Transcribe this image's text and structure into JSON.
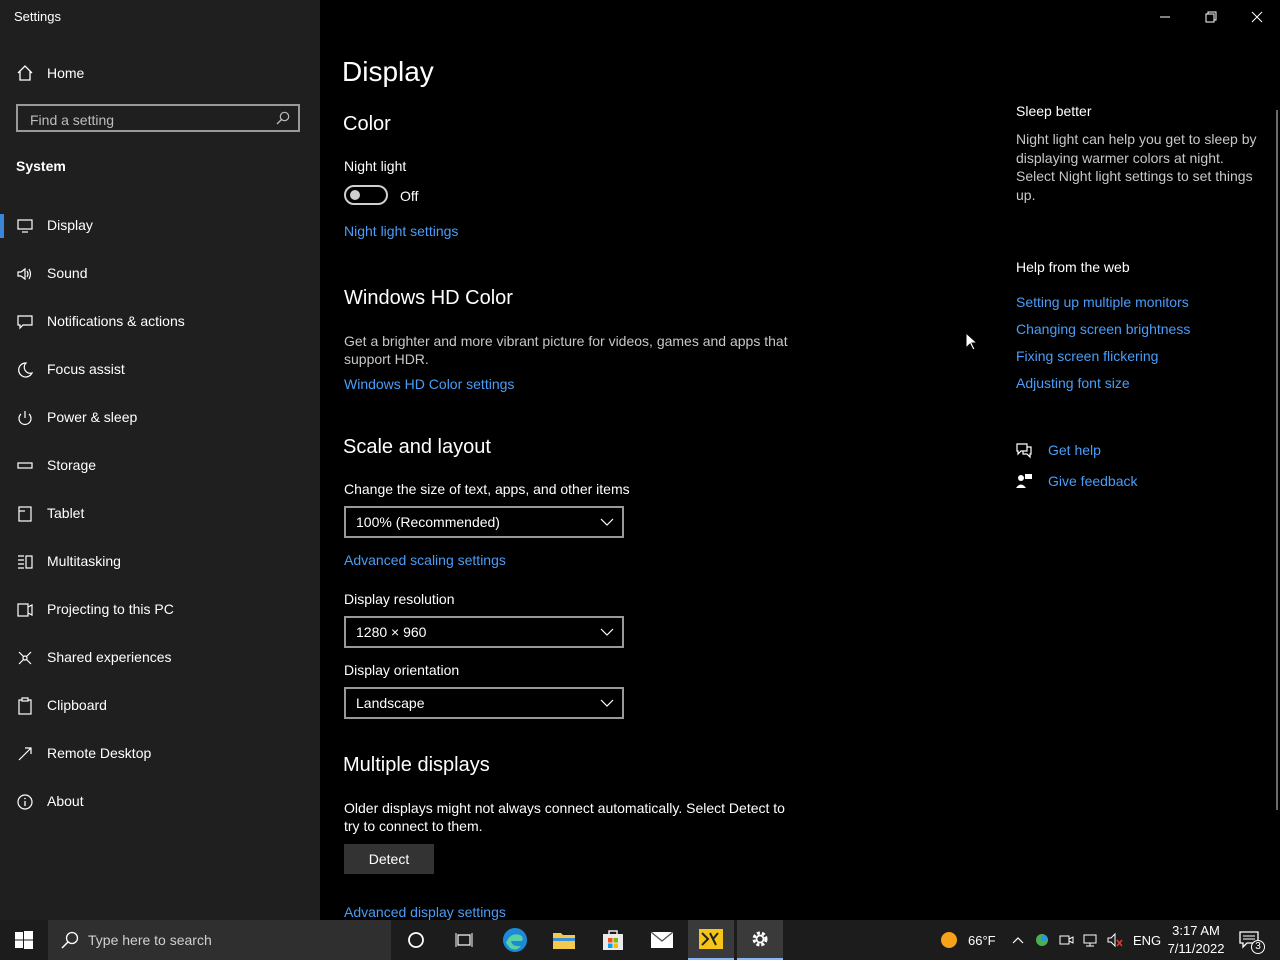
{
  "window": {
    "title": "Settings"
  },
  "sidebar": {
    "home_label": "Home",
    "search_placeholder": "Find a setting",
    "section_label": "System",
    "items": [
      {
        "label": "Display",
        "icon": "monitor-icon",
        "active": true
      },
      {
        "label": "Sound",
        "icon": "speaker-icon"
      },
      {
        "label": "Notifications & actions",
        "icon": "notification-icon"
      },
      {
        "label": "Focus assist",
        "icon": "moon-icon"
      },
      {
        "label": "Power & sleep",
        "icon": "power-icon"
      },
      {
        "label": "Storage",
        "icon": "storage-icon"
      },
      {
        "label": "Tablet",
        "icon": "tablet-icon"
      },
      {
        "label": "Multitasking",
        "icon": "multitasking-icon"
      },
      {
        "label": "Projecting to this PC",
        "icon": "projector-icon"
      },
      {
        "label": "Shared experiences",
        "icon": "shared-icon"
      },
      {
        "label": "Clipboard",
        "icon": "clipboard-icon"
      },
      {
        "label": "Remote Desktop",
        "icon": "remote-icon"
      },
      {
        "label": "About",
        "icon": "info-icon"
      }
    ]
  },
  "main": {
    "title": "Display",
    "color": {
      "heading": "Color",
      "night_light_label": "Night light",
      "toggle_state": "Off",
      "night_light_settings_link": "Night light settings"
    },
    "hd_color": {
      "heading": "Windows HD Color",
      "description": "Get a brighter and more vibrant picture for videos, games and apps that support HDR.",
      "settings_link": "Windows HD Color settings"
    },
    "scale": {
      "heading": "Scale and layout",
      "size_label": "Change the size of text, apps, and other items",
      "size_value": "100% (Recommended)",
      "advanced_scaling_link": "Advanced scaling settings",
      "resolution_label": "Display resolution",
      "resolution_value": "1280 × 960",
      "orientation_label": "Display orientation",
      "orientation_value": "Landscape"
    },
    "multiple": {
      "heading": "Multiple displays",
      "description": "Older displays might not always connect automatically. Select Detect to try to connect to them.",
      "detect_button": "Detect",
      "advanced_display_link": "Advanced display settings"
    }
  },
  "right": {
    "sleep_heading": "Sleep better",
    "sleep_text": "Night light can help you get to sleep by displaying warmer colors at night. Select Night light settings to set things up.",
    "help_heading": "Help from the web",
    "help_links": [
      "Setting up multiple monitors",
      "Changing screen brightness",
      "Fixing screen flickering",
      "Adjusting font size"
    ],
    "get_help": "Get help",
    "give_feedback": "Give feedback"
  },
  "taskbar": {
    "search_placeholder": "Type here to search",
    "weather_temp": "66°F",
    "language": "ENG",
    "time": "3:17 AM",
    "date": "7/11/2022",
    "notification_count": "3"
  },
  "colors": {
    "accent": "#4a9df8",
    "sidebar_bg": "#1f1f1f",
    "bg": "#000000"
  }
}
